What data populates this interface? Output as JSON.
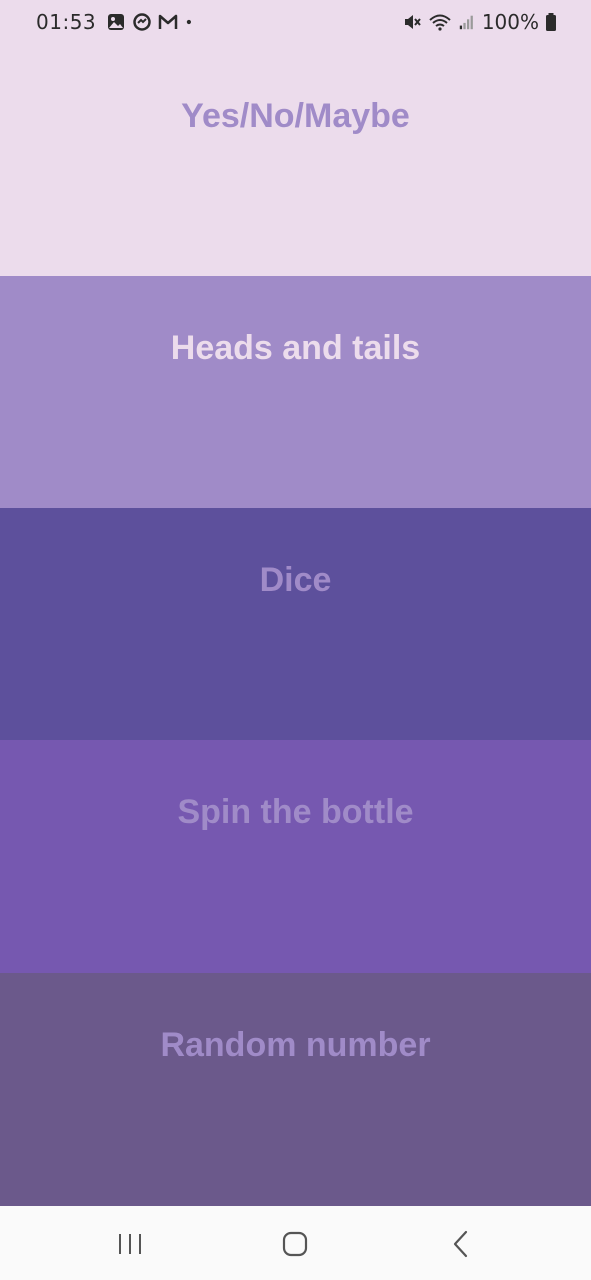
{
  "status_bar": {
    "time": "01:53",
    "battery": "100%",
    "icons_left": [
      "gallery-icon",
      "messenger-icon",
      "gmail-icon",
      "notification-dot-icon"
    ],
    "icons_right": [
      "mute-icon",
      "wifi-icon",
      "signal-icon",
      "battery-icon"
    ]
  },
  "tiles": [
    {
      "label": "Yes/No/Maybe",
      "bg": "#ecdcec",
      "fg": "#a08bc8"
    },
    {
      "label": "Heads and tails",
      "bg": "#a08bc8",
      "fg": "#ecdcec"
    },
    {
      "label": "Dice",
      "bg": "#5d509c",
      "fg": "#a08bc8"
    },
    {
      "label": "Spin the bottle",
      "bg": "#7658b0",
      "fg": "#a08bc8"
    },
    {
      "label": "Random number",
      "bg": "#6b598b",
      "fg": "#a08bc8"
    }
  ],
  "nav_bar": {
    "buttons": [
      "recent-apps",
      "home",
      "back"
    ]
  }
}
